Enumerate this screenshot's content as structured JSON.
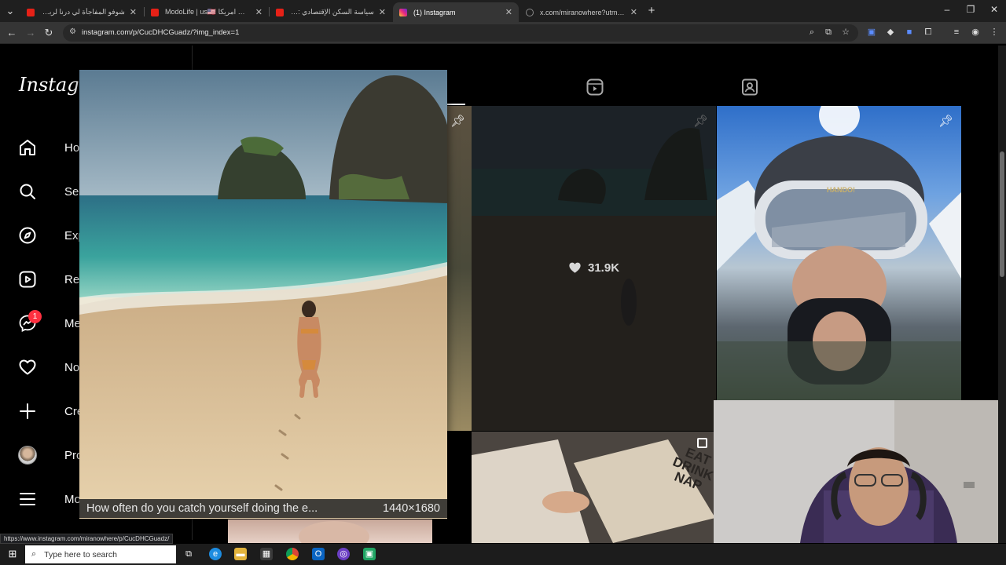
{
  "browser": {
    "tabs": [
      {
        "title": "شوفو المفاجأة لي درنا لربنا بمناسبة",
        "favicon": "youtube-icon",
        "active": false
      },
      {
        "title": "ModoLife | us🇺🇸 في امريكا DEF...",
        "favicon": "youtube-icon",
        "active": false
      },
      {
        "title": "سياسة السكن الإقتصادي : كيفاش...",
        "favicon": "youtube-icon",
        "active": false
      },
      {
        "title": "(1) Instagram",
        "favicon": "instagram-icon",
        "active": true
      },
      {
        "title": "x.com/miranowhere?utm_source...",
        "favicon": "x-icon",
        "active": false
      }
    ],
    "new_tab": "+",
    "url": "instagram.com/p/CucDHCGuadz/?img_index=1",
    "status_url": "https://www.instagram.com/miranowhere/p/CucDHCGuadz/"
  },
  "instagram": {
    "logo": "Instagram",
    "nav": [
      {
        "label": "Home",
        "icon": "home-icon"
      },
      {
        "label": "Search",
        "icon": "search-icon"
      },
      {
        "label": "Explore",
        "icon": "compass-icon"
      },
      {
        "label": "Reels",
        "icon": "reels-icon"
      },
      {
        "label": "Messages",
        "icon": "messenger-icon",
        "badge": "1"
      },
      {
        "label": "Notifications",
        "icon": "heart-icon"
      },
      {
        "label": "Create",
        "icon": "plus-icon"
      },
      {
        "label": "Profile",
        "icon": "avatar"
      },
      {
        "label": "More",
        "icon": "menu-icon"
      }
    ],
    "grid": {
      "hover_likes": "31.9K"
    },
    "preview": {
      "caption": "How often do you catch yourself doing the e...",
      "dimensions": "1440×1680"
    },
    "book_text": [
      "EAT",
      "DRINK",
      "NAP"
    ],
    "ski_helmet_text": "HANDO!"
  },
  "taskbar": {
    "search_placeholder": "Type here to search"
  },
  "colors": {
    "badge": "#ff3040",
    "chrome_bg": "#1f1f1f",
    "toolbar_bg": "#353535",
    "instagram_bg": "#000000"
  }
}
